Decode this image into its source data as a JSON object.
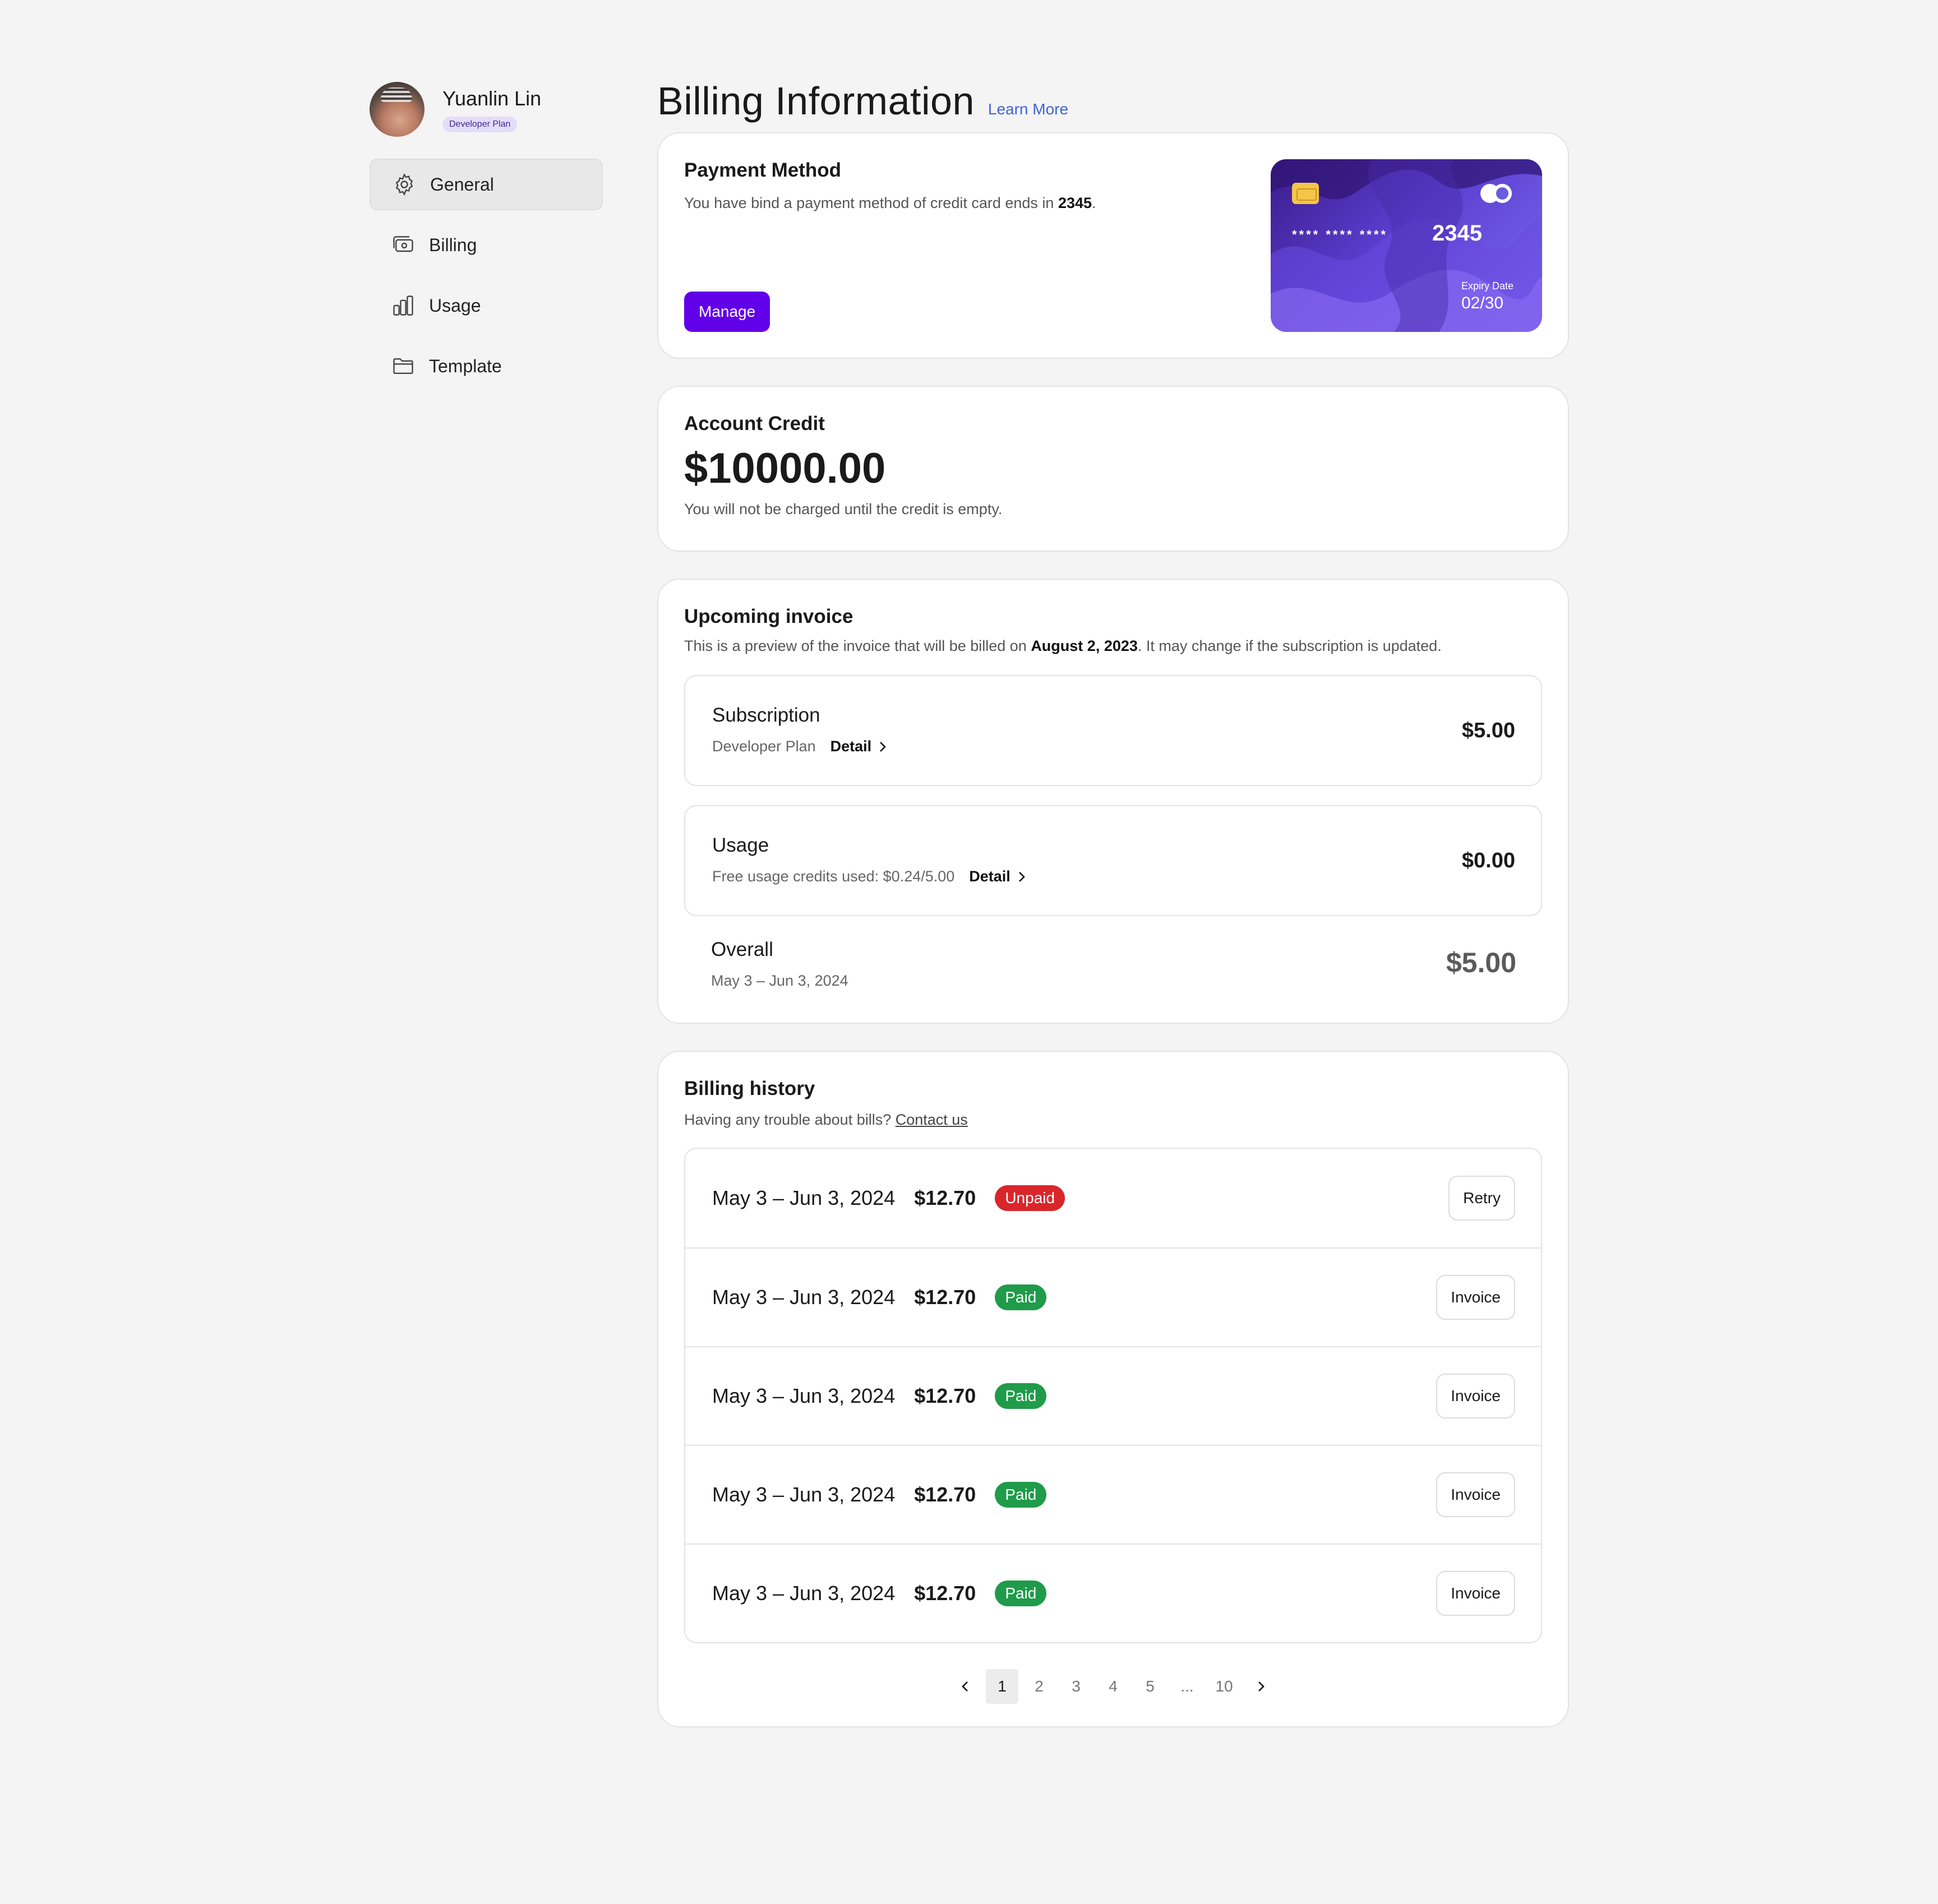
{
  "profile": {
    "name": "Yuanlin Lin",
    "plan": "Developer Plan"
  },
  "nav": [
    {
      "label": "General",
      "icon": "gear-icon",
      "active": true
    },
    {
      "label": "Billing",
      "icon": "billing-icon",
      "active": false
    },
    {
      "label": "Usage",
      "icon": "bar-chart-icon",
      "active": false
    },
    {
      "label": "Template",
      "icon": "folder-icon",
      "active": false
    }
  ],
  "header": {
    "title": "Billing Information",
    "learn_more": "Learn More"
  },
  "payment_method": {
    "title": "Payment Method",
    "desc_prefix": "You have bind a payment method of credit card ends in ",
    "last4": "2345",
    "desc_suffix": ".",
    "manage_label": "Manage",
    "card": {
      "mask": "**** **** ****",
      "last4": "2345",
      "expiry_label": "Expiry Date",
      "expiry": "02/30"
    }
  },
  "account_credit": {
    "title": "Account Credit",
    "amount": "$10000.00",
    "note": "You will not be charged until the credit is empty."
  },
  "upcoming_invoice": {
    "title": "Upcoming invoice",
    "desc_prefix": "This is a preview of the invoice that will be billed on ",
    "date": "August 2, 2023",
    "desc_suffix": ". It may change if the subscription is updated.",
    "subscription": {
      "title": "Subscription",
      "sub": "Developer Plan",
      "detail": "Detail",
      "amount": "$5.00"
    },
    "usage": {
      "title": "Usage",
      "sub": "Free usage credits used: $0.24/5.00",
      "detail": "Detail",
      "amount": "$0.00"
    },
    "overall": {
      "title": "Overall",
      "period": "May 3 – Jun 3, 2024",
      "amount": "$5.00"
    }
  },
  "billing_history": {
    "title": "Billing history",
    "desc": "Having any trouble about bills? ",
    "contact": "Contact us",
    "rows": [
      {
        "period": "May 3 – Jun 3, 2024",
        "amount": "$12.70",
        "status": "Unpaid",
        "action": "Retry"
      },
      {
        "period": "May 3 – Jun 3, 2024",
        "amount": "$12.70",
        "status": "Paid",
        "action": "Invoice"
      },
      {
        "period": "May 3 – Jun 3, 2024",
        "amount": "$12.70",
        "status": "Paid",
        "action": "Invoice"
      },
      {
        "period": "May 3 – Jun 3, 2024",
        "amount": "$12.70",
        "status": "Paid",
        "action": "Invoice"
      },
      {
        "period": "May 3 – Jun 3, 2024",
        "amount": "$12.70",
        "status": "Paid",
        "action": "Invoice"
      }
    ]
  },
  "pagination": {
    "pages": [
      "1",
      "2",
      "3",
      "4",
      "5",
      "...",
      "10"
    ],
    "current": "1"
  },
  "colors": {
    "accent": "#6200ea",
    "link": "#3f63d6",
    "unpaid": "#d9262b",
    "paid": "#1f9b4a"
  }
}
